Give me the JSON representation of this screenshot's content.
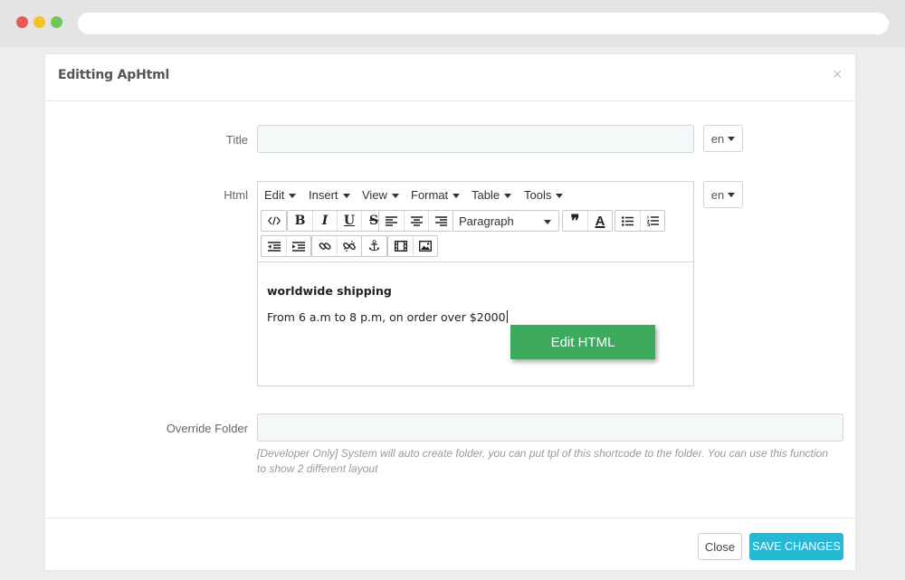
{
  "modal": {
    "title": "Editting ApHtml",
    "close_icon": "×"
  },
  "form": {
    "title_label": "Title",
    "title_value": "",
    "title_lang": "en",
    "html_label": "Html",
    "html_lang": "en",
    "override_label": "Override Folder",
    "override_value": "",
    "override_help": "[Developer Only] System will auto create folder, you can put tpl of this shortcode to the folder. You can use this function to show 2 different layout"
  },
  "editor": {
    "menus": [
      "Edit",
      "Insert",
      "View",
      "Format",
      "Table",
      "Tools"
    ],
    "format_select": "Paragraph",
    "icons": [
      "code-icon",
      "bold-icon",
      "italic-icon",
      "underline-icon",
      "strikethrough-icon",
      "align-left-icon",
      "align-center-icon",
      "align-right-icon",
      "blockquote-icon",
      "text-color-icon",
      "bullet-list-icon",
      "numbered-list-icon",
      "outdent-icon",
      "indent-icon",
      "link-icon",
      "unlink-icon",
      "anchor-icon",
      "media-icon",
      "image-icon"
    ],
    "content": {
      "heading": "worldwide shipping",
      "body": "From 6 a.m to 8 p.m, on order over $2000"
    },
    "edit_html_button": "Edit HTML"
  },
  "footer": {
    "close_label": "Close",
    "save_label": "SAVE CHANGES"
  },
  "colors": {
    "accent": "#25b9d7",
    "edit_html": "#3daa5e"
  }
}
